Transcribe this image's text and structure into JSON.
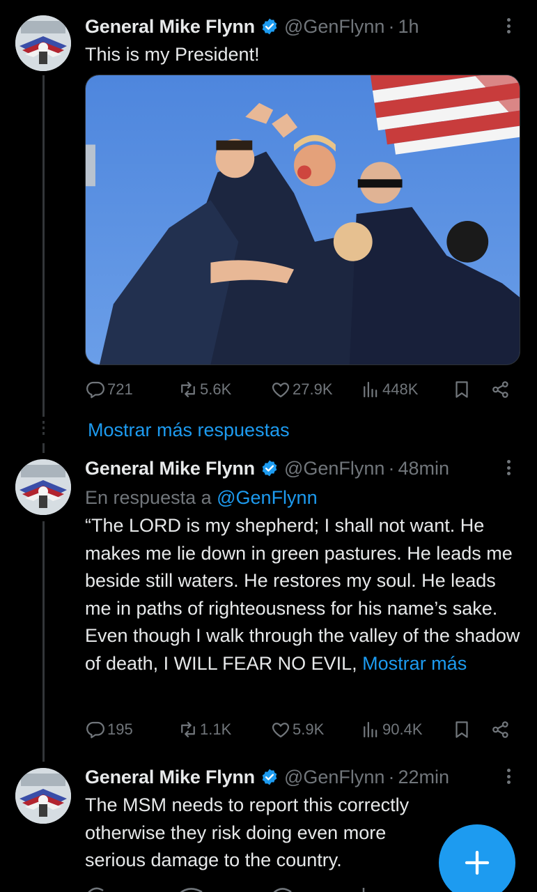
{
  "colors": {
    "accent": "#1d9bf0",
    "text": "#e7e9ea",
    "muted": "#71767b",
    "background": "#000000"
  },
  "tweets": [
    {
      "name": "General Mike Flynn",
      "handle": "@GenFlynn",
      "separator": "·",
      "time": "1h",
      "text": "This is my President!",
      "media": "photo",
      "replies": "721",
      "reposts": "5.6K",
      "likes": "27.9K",
      "views": "448K"
    },
    {
      "name": "General Mike Flynn",
      "handle": "@GenFlynn",
      "separator": "·",
      "time": "48min",
      "reply_prefix": "En respuesta a ",
      "reply_handle": "@GenFlynn",
      "text": "“The LORD is my shepherd; I shall not want. He makes me lie down in green pastures. He leads me beside still waters. He restores my soul. He leads me in paths of righteousness for his name’s sake. Even though I walk through the valley of the shadow of death, I WILL FEAR NO EVIL,",
      "show_more": "Mostrar más",
      "replies": "195",
      "reposts": "1.1K",
      "likes": "5.9K",
      "views": "90.4K"
    },
    {
      "name": "General Mike Flynn",
      "handle": "@GenFlynn",
      "separator": "·",
      "time": "22min",
      "text": "The MSM needs to report this correctly otherwise they risk doing even more serious damage to the country."
    }
  ],
  "show_more_replies": "Mostrar más respuestas",
  "icons": [
    "reply-icon",
    "repost-icon",
    "like-icon",
    "views-icon",
    "bookmark-icon",
    "share-icon",
    "verified-icon",
    "more-icon",
    "compose-icon"
  ]
}
